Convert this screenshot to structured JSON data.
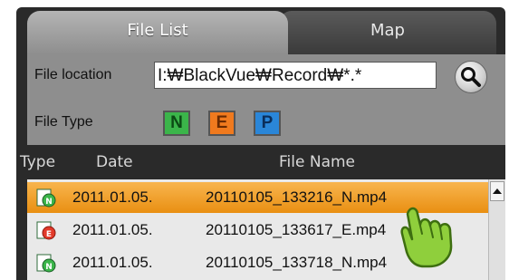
{
  "tabs": [
    {
      "label": "File List",
      "active": true
    },
    {
      "label": "Map",
      "active": false
    }
  ],
  "filter": {
    "location_label": "File location",
    "location_value": "I:₩BlackVue₩Record₩*.*",
    "search_icon": "magnifier-icon",
    "type_label": "File Type",
    "types": [
      {
        "label": "N",
        "color": "#3bb54a"
      },
      {
        "label": "E",
        "color": "#f07a1e"
      },
      {
        "label": "P",
        "color": "#2a86d8"
      }
    ]
  },
  "table": {
    "columns": [
      "Type",
      "Date",
      "File Name"
    ],
    "rows": [
      {
        "type": "N",
        "date": "2011.01.05.",
        "name": "20110105_133216_N.mp4",
        "selected": true
      },
      {
        "type": "E",
        "date": "2011.01.05.",
        "name": "20110105_133617_E.mp4",
        "selected": false
      },
      {
        "type": "N",
        "date": "2011.01.05.",
        "name": "20110105_133718_N.mp4",
        "selected": false
      }
    ]
  },
  "colors": {
    "selected_row": "#f0a030",
    "normal_icon": "#3bb54a",
    "event_icon": "#e23a2a"
  }
}
